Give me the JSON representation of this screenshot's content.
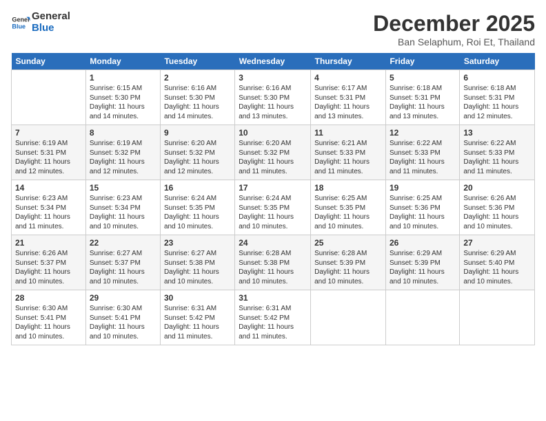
{
  "header": {
    "logo_line1": "General",
    "logo_line2": "Blue",
    "month": "December 2025",
    "location": "Ban Selaphum, Roi Et, Thailand"
  },
  "weekdays": [
    "Sunday",
    "Monday",
    "Tuesday",
    "Wednesday",
    "Thursday",
    "Friday",
    "Saturday"
  ],
  "weeks": [
    [
      {
        "day": "",
        "sunrise": "",
        "sunset": "",
        "daylight": ""
      },
      {
        "day": "1",
        "sunrise": "Sunrise: 6:15 AM",
        "sunset": "Sunset: 5:30 PM",
        "daylight": "Daylight: 11 hours and 14 minutes."
      },
      {
        "day": "2",
        "sunrise": "Sunrise: 6:16 AM",
        "sunset": "Sunset: 5:30 PM",
        "daylight": "Daylight: 11 hours and 14 minutes."
      },
      {
        "day": "3",
        "sunrise": "Sunrise: 6:16 AM",
        "sunset": "Sunset: 5:30 PM",
        "daylight": "Daylight: 11 hours and 13 minutes."
      },
      {
        "day": "4",
        "sunrise": "Sunrise: 6:17 AM",
        "sunset": "Sunset: 5:31 PM",
        "daylight": "Daylight: 11 hours and 13 minutes."
      },
      {
        "day": "5",
        "sunrise": "Sunrise: 6:18 AM",
        "sunset": "Sunset: 5:31 PM",
        "daylight": "Daylight: 11 hours and 13 minutes."
      },
      {
        "day": "6",
        "sunrise": "Sunrise: 6:18 AM",
        "sunset": "Sunset: 5:31 PM",
        "daylight": "Daylight: 11 hours and 12 minutes."
      }
    ],
    [
      {
        "day": "7",
        "sunrise": "Sunrise: 6:19 AM",
        "sunset": "Sunset: 5:31 PM",
        "daylight": "Daylight: 11 hours and 12 minutes."
      },
      {
        "day": "8",
        "sunrise": "Sunrise: 6:19 AM",
        "sunset": "Sunset: 5:32 PM",
        "daylight": "Daylight: 11 hours and 12 minutes."
      },
      {
        "day": "9",
        "sunrise": "Sunrise: 6:20 AM",
        "sunset": "Sunset: 5:32 PM",
        "daylight": "Daylight: 11 hours and 12 minutes."
      },
      {
        "day": "10",
        "sunrise": "Sunrise: 6:20 AM",
        "sunset": "Sunset: 5:32 PM",
        "daylight": "Daylight: 11 hours and 11 minutes."
      },
      {
        "day": "11",
        "sunrise": "Sunrise: 6:21 AM",
        "sunset": "Sunset: 5:33 PM",
        "daylight": "Daylight: 11 hours and 11 minutes."
      },
      {
        "day": "12",
        "sunrise": "Sunrise: 6:22 AM",
        "sunset": "Sunset: 5:33 PM",
        "daylight": "Daylight: 11 hours and 11 minutes."
      },
      {
        "day": "13",
        "sunrise": "Sunrise: 6:22 AM",
        "sunset": "Sunset: 5:33 PM",
        "daylight": "Daylight: 11 hours and 11 minutes."
      }
    ],
    [
      {
        "day": "14",
        "sunrise": "Sunrise: 6:23 AM",
        "sunset": "Sunset: 5:34 PM",
        "daylight": "Daylight: 11 hours and 11 minutes."
      },
      {
        "day": "15",
        "sunrise": "Sunrise: 6:23 AM",
        "sunset": "Sunset: 5:34 PM",
        "daylight": "Daylight: 11 hours and 10 minutes."
      },
      {
        "day": "16",
        "sunrise": "Sunrise: 6:24 AM",
        "sunset": "Sunset: 5:35 PM",
        "daylight": "Daylight: 11 hours and 10 minutes."
      },
      {
        "day": "17",
        "sunrise": "Sunrise: 6:24 AM",
        "sunset": "Sunset: 5:35 PM",
        "daylight": "Daylight: 11 hours and 10 minutes."
      },
      {
        "day": "18",
        "sunrise": "Sunrise: 6:25 AM",
        "sunset": "Sunset: 5:35 PM",
        "daylight": "Daylight: 11 hours and 10 minutes."
      },
      {
        "day": "19",
        "sunrise": "Sunrise: 6:25 AM",
        "sunset": "Sunset: 5:36 PM",
        "daylight": "Daylight: 11 hours and 10 minutes."
      },
      {
        "day": "20",
        "sunrise": "Sunrise: 6:26 AM",
        "sunset": "Sunset: 5:36 PM",
        "daylight": "Daylight: 11 hours and 10 minutes."
      }
    ],
    [
      {
        "day": "21",
        "sunrise": "Sunrise: 6:26 AM",
        "sunset": "Sunset: 5:37 PM",
        "daylight": "Daylight: 11 hours and 10 minutes."
      },
      {
        "day": "22",
        "sunrise": "Sunrise: 6:27 AM",
        "sunset": "Sunset: 5:37 PM",
        "daylight": "Daylight: 11 hours and 10 minutes."
      },
      {
        "day": "23",
        "sunrise": "Sunrise: 6:27 AM",
        "sunset": "Sunset: 5:38 PM",
        "daylight": "Daylight: 11 hours and 10 minutes."
      },
      {
        "day": "24",
        "sunrise": "Sunrise: 6:28 AM",
        "sunset": "Sunset: 5:38 PM",
        "daylight": "Daylight: 11 hours and 10 minutes."
      },
      {
        "day": "25",
        "sunrise": "Sunrise: 6:28 AM",
        "sunset": "Sunset: 5:39 PM",
        "daylight": "Daylight: 11 hours and 10 minutes."
      },
      {
        "day": "26",
        "sunrise": "Sunrise: 6:29 AM",
        "sunset": "Sunset: 5:39 PM",
        "daylight": "Daylight: 11 hours and 10 minutes."
      },
      {
        "day": "27",
        "sunrise": "Sunrise: 6:29 AM",
        "sunset": "Sunset: 5:40 PM",
        "daylight": "Daylight: 11 hours and 10 minutes."
      }
    ],
    [
      {
        "day": "28",
        "sunrise": "Sunrise: 6:30 AM",
        "sunset": "Sunset: 5:41 PM",
        "daylight": "Daylight: 11 hours and 10 minutes."
      },
      {
        "day": "29",
        "sunrise": "Sunrise: 6:30 AM",
        "sunset": "Sunset: 5:41 PM",
        "daylight": "Daylight: 11 hours and 10 minutes."
      },
      {
        "day": "30",
        "sunrise": "Sunrise: 6:31 AM",
        "sunset": "Sunset: 5:42 PM",
        "daylight": "Daylight: 11 hours and 11 minutes."
      },
      {
        "day": "31",
        "sunrise": "Sunrise: 6:31 AM",
        "sunset": "Sunset: 5:42 PM",
        "daylight": "Daylight: 11 hours and 11 minutes."
      },
      {
        "day": "",
        "sunrise": "",
        "sunset": "",
        "daylight": ""
      },
      {
        "day": "",
        "sunrise": "",
        "sunset": "",
        "daylight": ""
      },
      {
        "day": "",
        "sunrise": "",
        "sunset": "",
        "daylight": ""
      }
    ]
  ]
}
